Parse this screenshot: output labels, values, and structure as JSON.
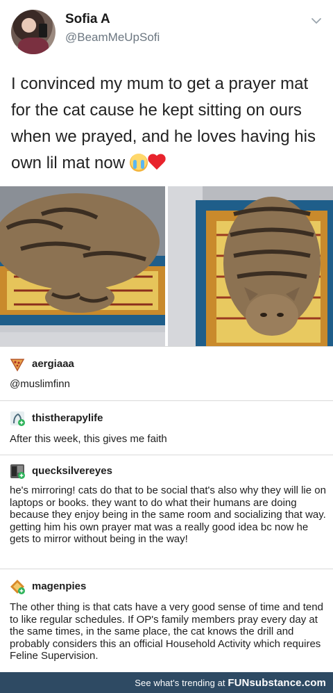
{
  "tweet": {
    "name": "Sofia A",
    "handle": "@BeamMeUpSofi",
    "text": "I convinced my mum to get a prayer mat for the cat cause he kept sitting on ours when we prayed, and he loves having his own lil mat now"
  },
  "notes": [
    {
      "username": "aergiaaa",
      "body": "@muslimfinn"
    },
    {
      "username": "thistherapylife",
      "body": "After this week, this gives me faith"
    },
    {
      "username": "quecksilvereyes",
      "body": "he's mirroring! cats do that to be social that's also why they will lie on laptops or books. they want to do what their humans are doing because they enjoy being in the same room and socializing that way. getting him his own prayer mat was a really good idea bc now he gets to mirror without being in the way!"
    },
    {
      "username": "magenpies",
      "body": "The other thing is that cats have a very good sense of time and tend to like regular schedules. If OP's family members pray every day at the same times, in the same place, the cat knows the drill and probably considers this an official Household Activity which requires Feline Supervision."
    }
  ],
  "footer": {
    "promo": "See what's trending at ",
    "brand": "FUNsubstance.com"
  },
  "colors": {
    "footer_bg": "#2e4a63",
    "handle": "#6b7680",
    "heart": "#e8232c"
  },
  "icons": [
    "chevron-down-icon",
    "crying-face-emoji",
    "red-heart-emoji",
    "pizza-slice-icon",
    "tumblr-follow-badge-icon"
  ]
}
